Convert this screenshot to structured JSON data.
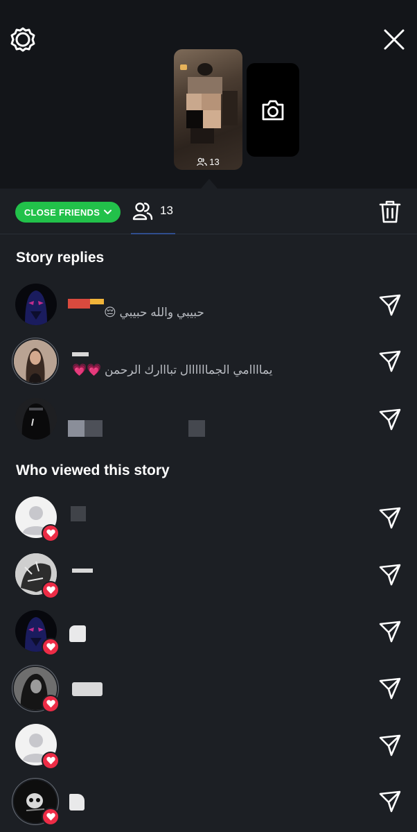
{
  "header": {
    "settings_icon": "gear-icon",
    "close_icon": "close-icon",
    "story_viewer_count": "13",
    "add_story_icon": "camera-icon"
  },
  "tabs": {
    "audience_label": "CLOSE FRIENDS",
    "audience_color": "#22c14a",
    "viewers_count": "13",
    "delete_icon": "trash-icon"
  },
  "replies": {
    "title": "Story replies",
    "items": [
      {
        "message": "حبيبي والله حبيبي 😔",
        "avatar": "dark-mask"
      },
      {
        "message": "يماااامي الجماااااال تبااارك الرحمن 💗💗",
        "avatar": "woman"
      },
      {
        "message": "",
        "avatar": "hooded"
      }
    ]
  },
  "viewers": {
    "title": "Who viewed this story",
    "items": [
      {
        "avatar": "default",
        "liked": true
      },
      {
        "avatar": "sketch",
        "liked": true
      },
      {
        "avatar": "dark-mask",
        "liked": true
      },
      {
        "avatar": "woman-bw",
        "liked": true
      },
      {
        "avatar": "default",
        "liked": true
      },
      {
        "avatar": "skull",
        "liked": true
      }
    ]
  },
  "colors": {
    "background": "#1c1f24",
    "like_badge": "#ed2c46",
    "tab_underline": "#2f4e8e"
  }
}
